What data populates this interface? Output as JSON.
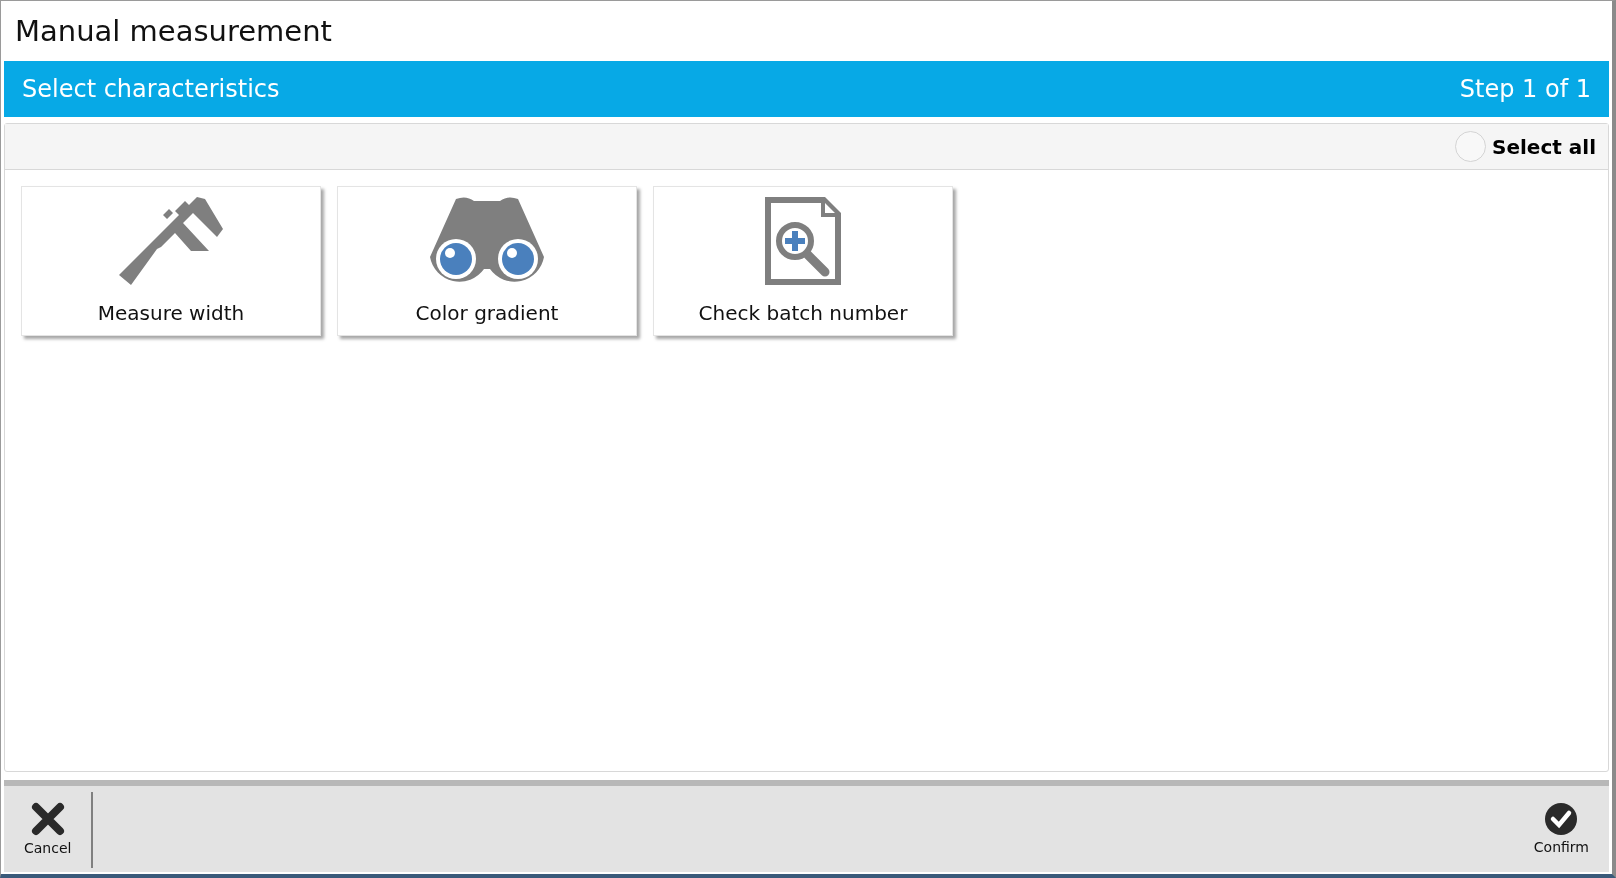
{
  "window": {
    "title": "Manual measurement"
  },
  "header": {
    "title": "Select characteristics",
    "step": "Step 1 of 1"
  },
  "select_all": {
    "label": "Select all",
    "checked": false
  },
  "tiles": [
    {
      "label": "Measure width",
      "kind": "caliper",
      "selected": false
    },
    {
      "label": "Color gradient",
      "kind": "binoculars",
      "selected": false
    },
    {
      "label": "Check batch number",
      "kind": "document",
      "selected": false
    }
  ],
  "footer": {
    "cancel": "Cancel",
    "confirm": "Confirm"
  }
}
